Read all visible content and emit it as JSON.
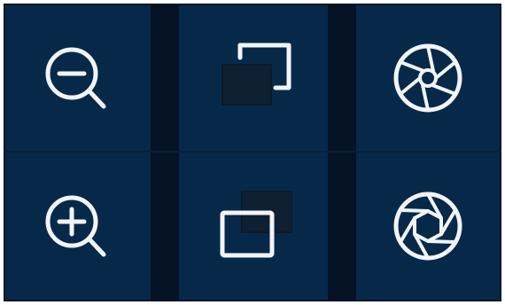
{
  "controls": [
    {
      "id": "zoom-out",
      "icon": "zoom-out-icon",
      "interactable": true
    },
    {
      "id": "window-back",
      "icon": "send-to-back-icon",
      "interactable": true
    },
    {
      "id": "iris-open",
      "icon": "aperture-open-icon",
      "interactable": true
    },
    {
      "id": "zoom-in",
      "icon": "zoom-in-icon",
      "interactable": true
    },
    {
      "id": "window-front",
      "icon": "bring-to-front-icon",
      "interactable": true
    },
    {
      "id": "iris-close",
      "icon": "aperture-close-icon",
      "interactable": true
    }
  ],
  "colors": {
    "background": "#061326",
    "tile": "#06294a",
    "icon_stroke": "#f2f4f7",
    "icon_dim": "#0f2033"
  }
}
